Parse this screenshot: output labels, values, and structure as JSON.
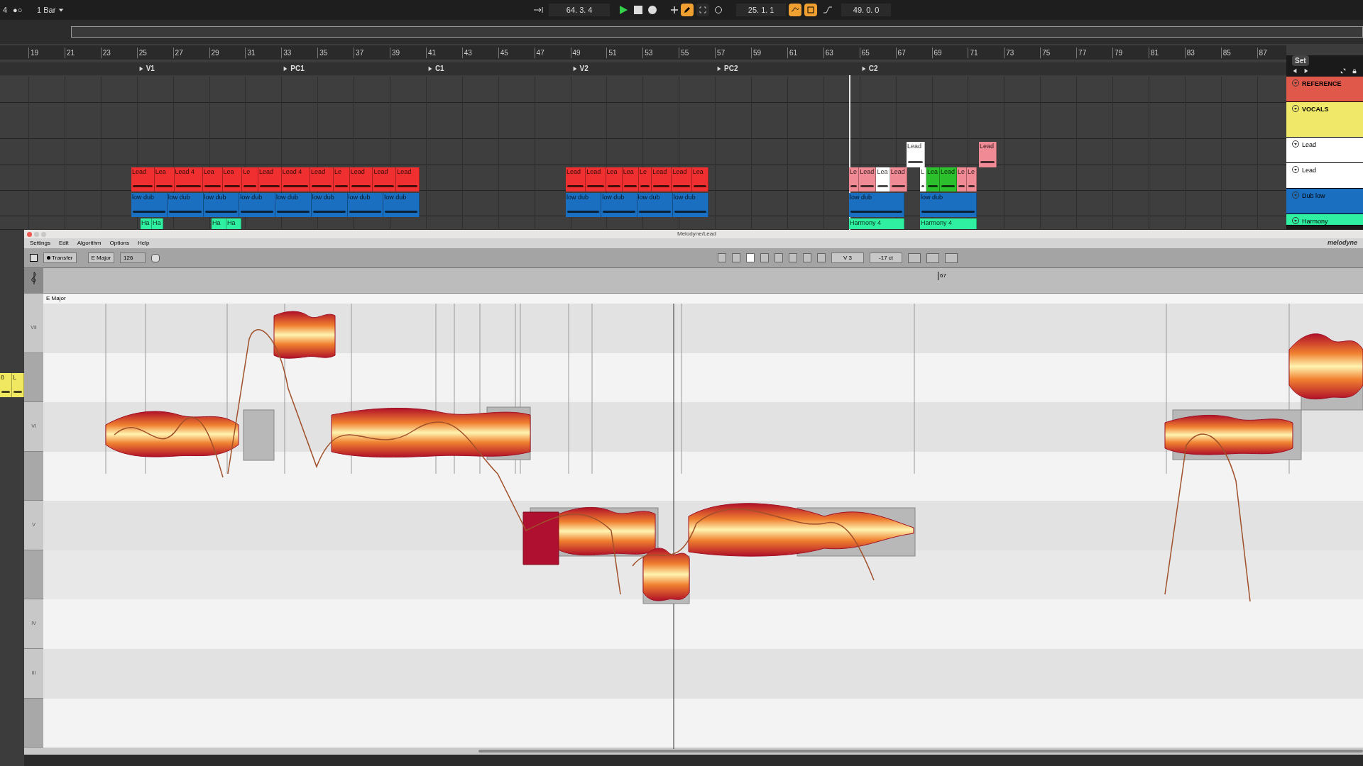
{
  "transport": {
    "quantize": "4",
    "mode": "●○",
    "grid": "1 Bar",
    "position": "64. 3. 4",
    "loop_start": "25. 1. 1",
    "loop_length": "49. 0. 0",
    "draw_mode": {
      "on": true
    },
    "follow": {
      "on": false
    },
    "loop": {
      "on": true
    },
    "punch": {
      "on": true
    }
  },
  "ruler": [
    "19",
    "21",
    "23",
    "25",
    "27",
    "29",
    "31",
    "33",
    "35",
    "37",
    "39",
    "41",
    "43",
    "45",
    "47",
    "49",
    "51",
    "53",
    "55",
    "57",
    "59",
    "61",
    "63",
    "65",
    "67",
    "69",
    "71",
    "73",
    "75",
    "77",
    "79",
    "81",
    "83",
    "85",
    "87"
  ],
  "locators": [
    "V1",
    "PC1",
    "C1",
    "V2",
    "PC2",
    "C2"
  ],
  "clip_groups": [
    {
      "clips": [
        {
          "label": "Lead",
          "color": "#ffffff"
        }
      ]
    },
    {
      "clips": [
        {
          "label": "Lead",
          "color": "#f08a95"
        }
      ]
    },
    {
      "clips": [
        {
          "label": "Lead",
          "color": "#f03030"
        },
        {
          "label": "Lea",
          "color": "#f03030"
        },
        {
          "label": "Lead 4",
          "color": "#f03030"
        },
        {
          "label": "Lea",
          "color": "#f03030"
        },
        {
          "label": "Lea",
          "color": "#f03030"
        },
        {
          "label": "Le",
          "color": "#f03030"
        },
        {
          "label": "Lead",
          "color": "#f03030"
        },
        {
          "label": "Lead 4",
          "color": "#f03030"
        },
        {
          "label": "Lead",
          "color": "#f03030"
        },
        {
          "label": "Le",
          "color": "#f03030"
        },
        {
          "label": "Lead",
          "color": "#f03030"
        },
        {
          "label": "Lead",
          "color": "#f03030"
        },
        {
          "label": "Lead",
          "color": "#f03030"
        }
      ]
    },
    {
      "clips": [
        {
          "label": "Lead",
          "color": "#f03030"
        },
        {
          "label": "Lead",
          "color": "#f03030"
        },
        {
          "label": "Lea",
          "color": "#f03030"
        },
        {
          "label": "Lea",
          "color": "#f03030"
        },
        {
          "label": "Le",
          "color": "#f03030"
        },
        {
          "label": "Lead",
          "color": "#f03030"
        },
        {
          "label": "Lead",
          "color": "#f03030"
        },
        {
          "label": "Lea",
          "color": "#f03030"
        }
      ]
    },
    {
      "clips": [
        {
          "label": "Le",
          "color": "#f08a95"
        },
        {
          "label": "Lead",
          "color": "#f08a95"
        },
        {
          "label": "Lea",
          "color": "#ffffff"
        },
        {
          "label": "Lead",
          "color": "#f08a95"
        }
      ]
    },
    {
      "clips": [
        {
          "label": "L",
          "color": "#ffffff"
        },
        {
          "label": "Lea",
          "color": "#2dc02d"
        },
        {
          "label": "Lead",
          "color": "#2dc02d"
        },
        {
          "label": "Le",
          "color": "#f08a95"
        },
        {
          "label": "Le",
          "color": "#f08a95"
        }
      ]
    },
    {
      "clips": [
        {
          "label": "low dub",
          "color": "#1a6fc0"
        },
        {
          "label": "low dub",
          "color": "#1a6fc0"
        },
        {
          "label": "low dub",
          "color": "#1a6fc0"
        },
        {
          "label": "low dub",
          "color": "#1a6fc0"
        },
        {
          "label": "low dub",
          "color": "#1a6fc0"
        },
        {
          "label": "low dub",
          "color": "#1a6fc0"
        },
        {
          "label": "low dub",
          "color": "#1a6fc0"
        },
        {
          "label": "low dub",
          "color": "#1a6fc0"
        }
      ]
    },
    {
      "clips": [
        {
          "label": "low dub",
          "color": "#1a6fc0"
        },
        {
          "label": "low dub",
          "color": "#1a6fc0"
        },
        {
          "label": "low dub",
          "color": "#1a6fc0"
        },
        {
          "label": "low dub",
          "color": "#1a6fc0"
        }
      ]
    },
    {
      "clips": [
        {
          "label": "low dub",
          "color": "#1a6fc0"
        }
      ]
    },
    {
      "clips": [
        {
          "label": "low dub",
          "color": "#1a6fc0"
        }
      ]
    },
    {
      "clips": [
        {
          "label": "Ha",
          "color": "#2ef0a0"
        },
        {
          "label": "Ha",
          "color": "#2ef0a0"
        }
      ]
    },
    {
      "clips": [
        {
          "label": "Ha",
          "color": "#2ef0a0"
        },
        {
          "label": "Ha",
          "color": "#2ef0a0"
        }
      ]
    },
    {
      "clips": [
        {
          "label": "Harmony 4",
          "color": "#2ef0a0"
        }
      ]
    },
    {
      "clips": [
        {
          "label": "Harmony 4",
          "color": "#2ef0a0"
        }
      ]
    },
    {
      "clips": [
        {
          "label": "8",
          "color": "#f0e860"
        },
        {
          "label": "L",
          "color": "#f0e860"
        }
      ]
    }
  ],
  "set_panel": {
    "title": "Set",
    "tracks": [
      {
        "name": "REFERENCE",
        "color": "#e0584a"
      },
      {
        "name": "VOCALS",
        "color": "#f0e868"
      },
      {
        "name": "Lead",
        "color": "#ffffff"
      },
      {
        "name": "Lead",
        "color": "#ffffff"
      },
      {
        "name": "Dub low",
        "color": "#1a6fc0"
      },
      {
        "name": "Harmony",
        "color": "#2ef0a0"
      }
    ]
  },
  "melodyne": {
    "title": "Melodyne/Lead",
    "menu": [
      "Settings",
      "Edit",
      "Algorithm",
      "Options",
      "Help"
    ],
    "brand": "melodyne",
    "transfer": "Transfer",
    "scale": "E Major",
    "tempo": "126",
    "pitch_value": "V 3",
    "cents": "-17 ct",
    "bar_marker": "67",
    "key_label": "E Major",
    "pitch_rows": [
      "VII",
      "VI",
      "V",
      "IV",
      "III"
    ]
  }
}
